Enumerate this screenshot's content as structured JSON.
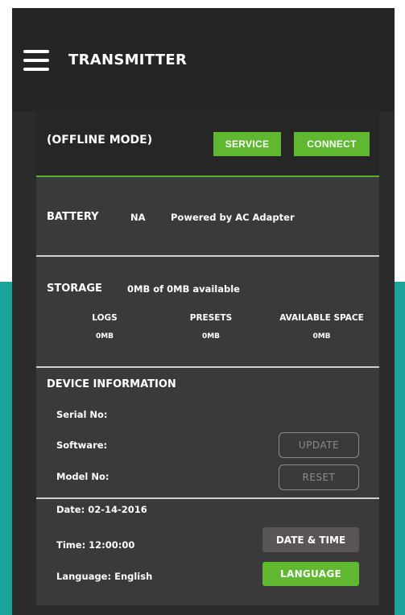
{
  "header": {
    "title": "TRANSMITTER"
  },
  "mode": {
    "label": "(OFFLINE MODE)",
    "service_label": "SERVICE",
    "connect_label": "CONNECT"
  },
  "battery": {
    "label": "BATTERY",
    "value": "NA",
    "source": "Powered by AC Adapter"
  },
  "storage": {
    "label": "STORAGE",
    "summary": "0MB of 0MB available",
    "columns": [
      {
        "label": "LOGS",
        "value": "0MB"
      },
      {
        "label": "PRESETS",
        "value": "0MB"
      },
      {
        "label": "AVAILABLE SPACE",
        "value": "0MB"
      }
    ]
  },
  "device": {
    "label": "DEVICE INFORMATION",
    "serial_label": "Serial No:",
    "software_label": "Software:",
    "model_label": "Model No:",
    "update_label": "UPDATE",
    "reset_label": "RESET"
  },
  "settings": {
    "date": "Date: 02-14-2016",
    "time": "Time: 12:00:00",
    "language": "Language: English",
    "date_time_label": "DATE & TIME",
    "language_button_label": "LANGUAGE"
  },
  "colors": {
    "accent_green": "#5fb830",
    "teal_background": "#1aa39a",
    "panel": "#3a3a3a"
  }
}
